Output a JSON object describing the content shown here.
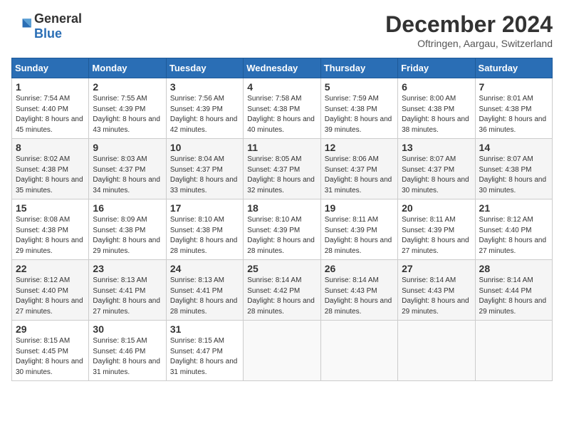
{
  "logo": {
    "general": "General",
    "blue": "Blue"
  },
  "header": {
    "month": "December 2024",
    "location": "Oftringen, Aargau, Switzerland"
  },
  "days_of_week": [
    "Sunday",
    "Monday",
    "Tuesday",
    "Wednesday",
    "Thursday",
    "Friday",
    "Saturday"
  ],
  "weeks": [
    [
      {
        "day": "1",
        "sunrise": "7:54 AM",
        "sunset": "4:40 PM",
        "daylight": "8 hours and 45 minutes."
      },
      {
        "day": "2",
        "sunrise": "7:55 AM",
        "sunset": "4:39 PM",
        "daylight": "8 hours and 43 minutes."
      },
      {
        "day": "3",
        "sunrise": "7:56 AM",
        "sunset": "4:39 PM",
        "daylight": "8 hours and 42 minutes."
      },
      {
        "day": "4",
        "sunrise": "7:58 AM",
        "sunset": "4:38 PM",
        "daylight": "8 hours and 40 minutes."
      },
      {
        "day": "5",
        "sunrise": "7:59 AM",
        "sunset": "4:38 PM",
        "daylight": "8 hours and 39 minutes."
      },
      {
        "day": "6",
        "sunrise": "8:00 AM",
        "sunset": "4:38 PM",
        "daylight": "8 hours and 38 minutes."
      },
      {
        "day": "7",
        "sunrise": "8:01 AM",
        "sunset": "4:38 PM",
        "daylight": "8 hours and 36 minutes."
      }
    ],
    [
      {
        "day": "8",
        "sunrise": "8:02 AM",
        "sunset": "4:38 PM",
        "daylight": "8 hours and 35 minutes."
      },
      {
        "day": "9",
        "sunrise": "8:03 AM",
        "sunset": "4:37 PM",
        "daylight": "8 hours and 34 minutes."
      },
      {
        "day": "10",
        "sunrise": "8:04 AM",
        "sunset": "4:37 PM",
        "daylight": "8 hours and 33 minutes."
      },
      {
        "day": "11",
        "sunrise": "8:05 AM",
        "sunset": "4:37 PM",
        "daylight": "8 hours and 32 minutes."
      },
      {
        "day": "12",
        "sunrise": "8:06 AM",
        "sunset": "4:37 PM",
        "daylight": "8 hours and 31 minutes."
      },
      {
        "day": "13",
        "sunrise": "8:07 AM",
        "sunset": "4:37 PM",
        "daylight": "8 hours and 30 minutes."
      },
      {
        "day": "14",
        "sunrise": "8:07 AM",
        "sunset": "4:38 PM",
        "daylight": "8 hours and 30 minutes."
      }
    ],
    [
      {
        "day": "15",
        "sunrise": "8:08 AM",
        "sunset": "4:38 PM",
        "daylight": "8 hours and 29 minutes."
      },
      {
        "day": "16",
        "sunrise": "8:09 AM",
        "sunset": "4:38 PM",
        "daylight": "8 hours and 29 minutes."
      },
      {
        "day": "17",
        "sunrise": "8:10 AM",
        "sunset": "4:38 PM",
        "daylight": "8 hours and 28 minutes."
      },
      {
        "day": "18",
        "sunrise": "8:10 AM",
        "sunset": "4:39 PM",
        "daylight": "8 hours and 28 minutes."
      },
      {
        "day": "19",
        "sunrise": "8:11 AM",
        "sunset": "4:39 PM",
        "daylight": "8 hours and 28 minutes."
      },
      {
        "day": "20",
        "sunrise": "8:11 AM",
        "sunset": "4:39 PM",
        "daylight": "8 hours and 27 minutes."
      },
      {
        "day": "21",
        "sunrise": "8:12 AM",
        "sunset": "4:40 PM",
        "daylight": "8 hours and 27 minutes."
      }
    ],
    [
      {
        "day": "22",
        "sunrise": "8:12 AM",
        "sunset": "4:40 PM",
        "daylight": "8 hours and 27 minutes."
      },
      {
        "day": "23",
        "sunrise": "8:13 AM",
        "sunset": "4:41 PM",
        "daylight": "8 hours and 27 minutes."
      },
      {
        "day": "24",
        "sunrise": "8:13 AM",
        "sunset": "4:41 PM",
        "daylight": "8 hours and 28 minutes."
      },
      {
        "day": "25",
        "sunrise": "8:14 AM",
        "sunset": "4:42 PM",
        "daylight": "8 hours and 28 minutes."
      },
      {
        "day": "26",
        "sunrise": "8:14 AM",
        "sunset": "4:43 PM",
        "daylight": "8 hours and 28 minutes."
      },
      {
        "day": "27",
        "sunrise": "8:14 AM",
        "sunset": "4:43 PM",
        "daylight": "8 hours and 29 minutes."
      },
      {
        "day": "28",
        "sunrise": "8:14 AM",
        "sunset": "4:44 PM",
        "daylight": "8 hours and 29 minutes."
      }
    ],
    [
      {
        "day": "29",
        "sunrise": "8:15 AM",
        "sunset": "4:45 PM",
        "daylight": "8 hours and 30 minutes."
      },
      {
        "day": "30",
        "sunrise": "8:15 AM",
        "sunset": "4:46 PM",
        "daylight": "8 hours and 31 minutes."
      },
      {
        "day": "31",
        "sunrise": "8:15 AM",
        "sunset": "4:47 PM",
        "daylight": "8 hours and 31 minutes."
      },
      null,
      null,
      null,
      null
    ]
  ],
  "labels": {
    "sunrise": "Sunrise:",
    "sunset": "Sunset:",
    "daylight": "Daylight:"
  }
}
